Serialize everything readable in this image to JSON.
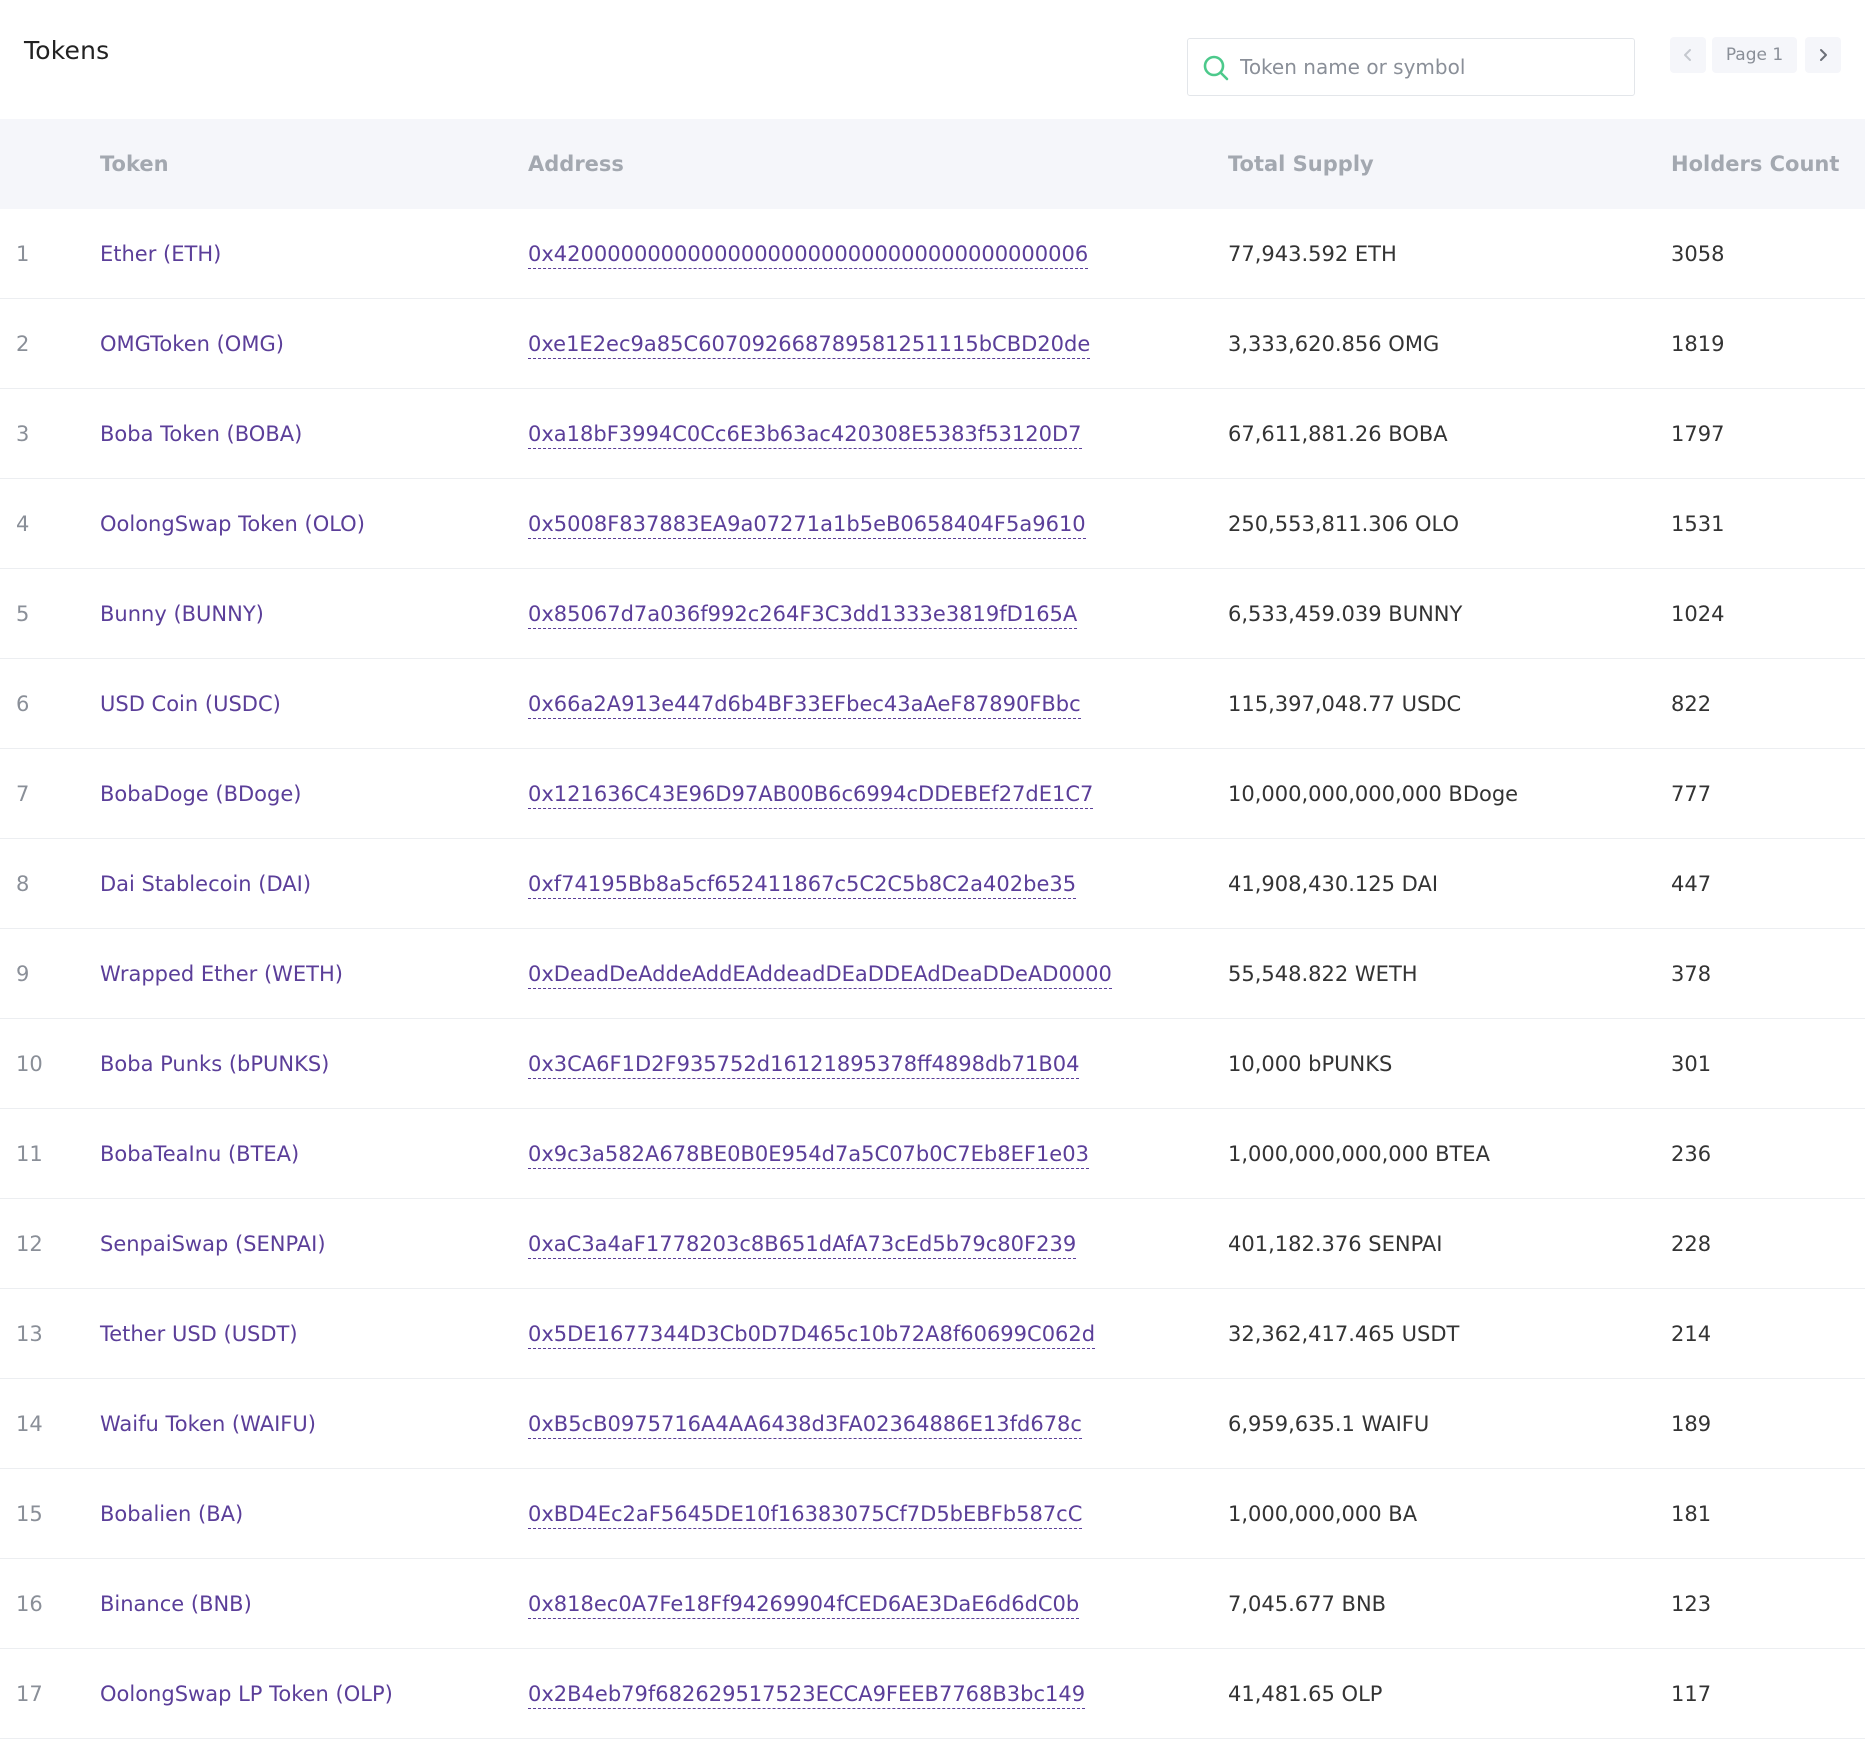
{
  "page": {
    "title": "Tokens"
  },
  "search": {
    "placeholder": "Token name or symbol",
    "value": ""
  },
  "pagination": {
    "label": "Page 1"
  },
  "icons": {
    "search": "search-icon",
    "prev": "chevron-left-icon",
    "next": "chevron-right-icon"
  },
  "colors": {
    "link": "#5b3e99",
    "header_bg": "#f5f6fa",
    "search_icon": "#4cc98b"
  },
  "table": {
    "headers": {
      "token": "Token",
      "address": "Address",
      "total_supply": "Total Supply",
      "holders_count": "Holders Count"
    },
    "rows": [
      {
        "rank": "1",
        "token": "Ether (ETH)",
        "address": "0x4200000000000000000000000000000000000006",
        "supply": "77,943.592 ETH",
        "holders": "3058"
      },
      {
        "rank": "2",
        "token": "OMGToken (OMG)",
        "address": "0xe1E2ec9a85C607092668789581251115bCBD20de",
        "supply": "3,333,620.856 OMG",
        "holders": "1819"
      },
      {
        "rank": "3",
        "token": "Boba Token (BOBA)",
        "address": "0xa18bF3994C0Cc6E3b63ac420308E5383f53120D7",
        "supply": "67,611,881.26 BOBA",
        "holders": "1797"
      },
      {
        "rank": "4",
        "token": "OolongSwap Token (OLO)",
        "address": "0x5008F837883EA9a07271a1b5eB0658404F5a9610",
        "supply": "250,553,811.306 OLO",
        "holders": "1531"
      },
      {
        "rank": "5",
        "token": "Bunny (BUNNY)",
        "address": "0x85067d7a036f992c264F3C3dd1333e3819fD165A",
        "supply": "6,533,459.039 BUNNY",
        "holders": "1024"
      },
      {
        "rank": "6",
        "token": "USD Coin (USDC)",
        "address": "0x66a2A913e447d6b4BF33EFbec43aAeF87890FBbc",
        "supply": "115,397,048.77 USDC",
        "holders": "822"
      },
      {
        "rank": "7",
        "token": "BobaDoge (BDoge)",
        "address": "0x121636C43E96D97AB00B6c6994cDDEBEf27dE1C7",
        "supply": "10,000,000,000,000 BDoge",
        "holders": "777"
      },
      {
        "rank": "8",
        "token": "Dai Stablecoin (DAI)",
        "address": "0xf74195Bb8a5cf652411867c5C2C5b8C2a402be35",
        "supply": "41,908,430.125 DAI",
        "holders": "447"
      },
      {
        "rank": "9",
        "token": "Wrapped Ether (WETH)",
        "address": "0xDeadDeAddeAddEAddeadDEaDDEAdDeaDDeAD0000",
        "supply": "55,548.822 WETH",
        "holders": "378"
      },
      {
        "rank": "10",
        "token": "Boba Punks (bPUNKS)",
        "address": "0x3CA6F1D2F935752d16121895378ff4898db71B04",
        "supply": "10,000 bPUNKS",
        "holders": "301"
      },
      {
        "rank": "11",
        "token": "BobaTeaInu (BTEA)",
        "address": "0x9c3a582A678BE0B0E954d7a5C07b0C7Eb8EF1e03",
        "supply": "1,000,000,000,000 BTEA",
        "holders": "236"
      },
      {
        "rank": "12",
        "token": "SenpaiSwap (SENPAI)",
        "address": "0xaC3a4aF1778203c8B651dAfA73cEd5b79c80F239",
        "supply": "401,182.376 SENPAI",
        "holders": "228"
      },
      {
        "rank": "13",
        "token": "Tether USD (USDT)",
        "address": "0x5DE1677344D3Cb0D7D465c10b72A8f60699C062d",
        "supply": "32,362,417.465 USDT",
        "holders": "214"
      },
      {
        "rank": "14",
        "token": "Waifu Token (WAIFU)",
        "address": "0xB5cB0975716A4AA6438d3FA02364886E13fd678c",
        "supply": "6,959,635.1 WAIFU",
        "holders": "189"
      },
      {
        "rank": "15",
        "token": "Bobalien (BA)",
        "address": "0xBD4Ec2aF5645DE10f16383075Cf7D5bEBFb587cC",
        "supply": "1,000,000,000 BA",
        "holders": "181"
      },
      {
        "rank": "16",
        "token": "Binance (BNB)",
        "address": "0x818ec0A7Fe18Ff94269904fCED6AE3DaE6d6dC0b",
        "supply": "7,045.677 BNB",
        "holders": "123"
      },
      {
        "rank": "17",
        "token": "OolongSwap LP Token (OLP)",
        "address": "0x2B4eb79f682629517523ECCA9FEEB7768B3bc149",
        "supply": "41,481.65 OLP",
        "holders": "117"
      }
    ]
  }
}
